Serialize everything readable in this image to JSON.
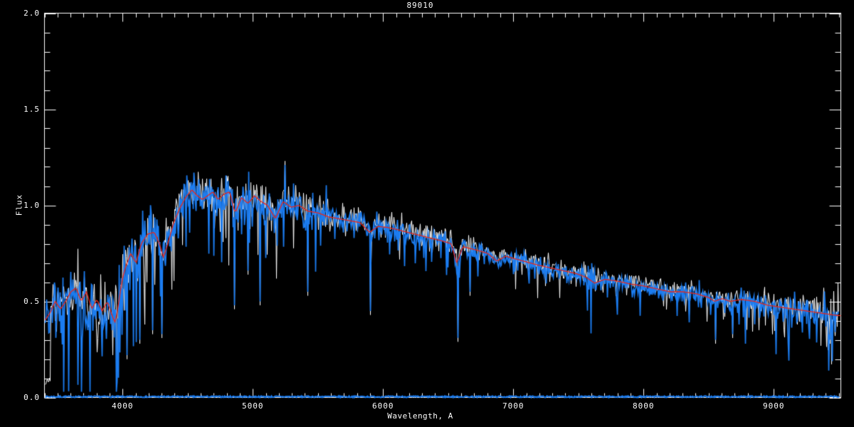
{
  "window": {
    "background": "#000000"
  },
  "chart_data": {
    "type": "line",
    "title": "89010",
    "xlabel": "Wavelength, A",
    "ylabel": "Flux",
    "xlim": [
      3400,
      9515
    ],
    "ylim": [
      0.0,
      2.0
    ],
    "grid": false,
    "legend": null,
    "x_major_ticks": [
      4000,
      5000,
      6000,
      7000,
      8000,
      9000
    ],
    "x_major_labels": [
      "4000",
      "5000",
      "6000",
      "7000",
      "8000",
      "9000"
    ],
    "x_minor_step": 100,
    "y_major_ticks": [
      0.0,
      0.5,
      1.0,
      1.5,
      2.0
    ],
    "y_major_labels": [
      "0.0",
      "0.5",
      "1.0",
      "1.5",
      "2.0"
    ],
    "y_minor_step": 0.1,
    "colors": {
      "background": "#000000",
      "axis": "#FFFFFF",
      "observed_blue": "#1B7CF0",
      "observed_white": "#FFFFFF",
      "template_red": "#E6281E"
    },
    "continuum": [
      [
        3400,
        0.4
      ],
      [
        3440,
        0.44
      ],
      [
        3480,
        0.5
      ],
      [
        3520,
        0.46
      ],
      [
        3560,
        0.5
      ],
      [
        3600,
        0.55
      ],
      [
        3640,
        0.57
      ],
      [
        3680,
        0.5
      ],
      [
        3720,
        0.55
      ],
      [
        3760,
        0.46
      ],
      [
        3800,
        0.51
      ],
      [
        3840,
        0.45
      ],
      [
        3880,
        0.5
      ],
      [
        3920,
        0.42
      ],
      [
        3940,
        0.39
      ],
      [
        3965,
        0.48
      ],
      [
        3990,
        0.6
      ],
      [
        4020,
        0.68
      ],
      [
        4060,
        0.75
      ],
      [
        4101,
        0.7
      ],
      [
        4140,
        0.8
      ],
      [
        4190,
        0.85
      ],
      [
        4240,
        0.86
      ],
      [
        4280,
        0.8
      ],
      [
        4310,
        0.73
      ],
      [
        4340,
        0.79
      ],
      [
        4390,
        0.91
      ],
      [
        4440,
        0.99
      ],
      [
        4490,
        1.05
      ],
      [
        4530,
        1.08
      ],
      [
        4570,
        1.05
      ],
      [
        4610,
        1.03
      ],
      [
        4650,
        1.05
      ],
      [
        4690,
        1.07
      ],
      [
        4730,
        1.03
      ],
      [
        4780,
        1.06
      ],
      [
        4820,
        1.07
      ],
      [
        4861,
        0.96
      ],
      [
        4910,
        1.04
      ],
      [
        4960,
        1.01
      ],
      [
        5010,
        1.05
      ],
      [
        5060,
        1.02
      ],
      [
        5110,
        1.0
      ],
      [
        5170,
        0.93
      ],
      [
        5230,
        1.02
      ],
      [
        5290,
        0.99
      ],
      [
        5350,
        1.0
      ],
      [
        5420,
        0.97
      ],
      [
        5500,
        0.96
      ],
      [
        5580,
        0.94
      ],
      [
        5660,
        0.93
      ],
      [
        5740,
        0.92
      ],
      [
        5820,
        0.91
      ],
      [
        5893,
        0.86
      ],
      [
        5960,
        0.89
      ],
      [
        6030,
        0.885
      ],
      [
        6100,
        0.875
      ],
      [
        6180,
        0.86
      ],
      [
        6270,
        0.845
      ],
      [
        6360,
        0.83
      ],
      [
        6450,
        0.815
      ],
      [
        6520,
        0.8
      ],
      [
        6563,
        0.7
      ],
      [
        6610,
        0.785
      ],
      [
        6700,
        0.77
      ],
      [
        6800,
        0.75
      ],
      [
        6870,
        0.71
      ],
      [
        6940,
        0.735
      ],
      [
        7020,
        0.72
      ],
      [
        7100,
        0.705
      ],
      [
        7180,
        0.69
      ],
      [
        7280,
        0.675
      ],
      [
        7380,
        0.66
      ],
      [
        7480,
        0.645
      ],
      [
        7560,
        0.625
      ],
      [
        7620,
        0.595
      ],
      [
        7700,
        0.615
      ],
      [
        7800,
        0.605
      ],
      [
        7900,
        0.59
      ],
      [
        8000,
        0.58
      ],
      [
        8100,
        0.565
      ],
      [
        8200,
        0.55
      ],
      [
        8300,
        0.55
      ],
      [
        8400,
        0.54
      ],
      [
        8500,
        0.52
      ],
      [
        8542,
        0.5
      ],
      [
        8600,
        0.515
      ],
      [
        8662,
        0.5
      ],
      [
        8750,
        0.51
      ],
      [
        8850,
        0.5
      ],
      [
        8950,
        0.48
      ],
      [
        9050,
        0.47
      ],
      [
        9150,
        0.46
      ],
      [
        9250,
        0.45
      ],
      [
        9350,
        0.44
      ],
      [
        9450,
        0.43
      ],
      [
        9515,
        0.425
      ]
    ],
    "noise_profile": [
      [
        3400,
        0.095
      ],
      [
        3900,
        0.105
      ],
      [
        3990,
        0.09
      ],
      [
        4050,
        0.075
      ],
      [
        4500,
        0.065
      ],
      [
        5000,
        0.055
      ],
      [
        5400,
        0.05
      ],
      [
        5800,
        0.042
      ],
      [
        6100,
        0.038
      ],
      [
        6500,
        0.032
      ],
      [
        7000,
        0.028
      ],
      [
        7500,
        0.03
      ],
      [
        7580,
        0.05
      ],
      [
        7660,
        0.026
      ],
      [
        8000,
        0.024
      ],
      [
        8400,
        0.026
      ],
      [
        8700,
        0.03
      ],
      [
        9000,
        0.035
      ],
      [
        9200,
        0.048
      ],
      [
        9515,
        0.058
      ]
    ],
    "noise": {
      "dip_probability": 0.12,
      "dip_scale": 6.0
    },
    "down_spikes": [
      [
        3955,
        0.08
      ],
      [
        4033,
        0.22
      ],
      [
        4131,
        0.3
      ],
      [
        4227,
        0.35
      ],
      [
        4300,
        0.33
      ],
      [
        4858,
        0.48
      ],
      [
        4962,
        0.66
      ],
      [
        5055,
        0.5
      ],
      [
        5420,
        0.55
      ],
      [
        5902,
        0.45
      ],
      [
        6574,
        0.31
      ],
      [
        6667,
        0.55
      ],
      [
        8553,
        0.3
      ],
      [
        8622,
        0.44
      ],
      [
        8679,
        0.33
      ],
      [
        9180,
        0.4
      ],
      [
        9432,
        0.3
      ],
      [
        9470,
        0.34
      ]
    ],
    "up_spikes": [
      [
        5246,
        1.21
      ]
    ],
    "series": [
      {
        "name": "observed-spectrum-white",
        "color": "#FFFFFF",
        "role": "spectrum",
        "seed": 20177,
        "offset": 0.012,
        "line_width": 1.0,
        "end_wl": 9500
      },
      {
        "name": "observed-spectrum-blue",
        "color": "#1B7CF0",
        "role": "spectrum",
        "seed": 90210,
        "offset": -0.004,
        "line_width": 1.7,
        "end_wl": 9500
      },
      {
        "name": "template-fit-red",
        "color": "#E6281E",
        "role": "template",
        "line_width": 1.3,
        "end_wl": 9515
      },
      {
        "name": "zero-level-blue",
        "color": "#1B7CF0",
        "role": "zero",
        "flux": 0.004,
        "line_width": 2.0,
        "end_wl": 9505
      }
    ],
    "white_start": {
      "until_wl": 3444,
      "flux": 0.09
    }
  }
}
